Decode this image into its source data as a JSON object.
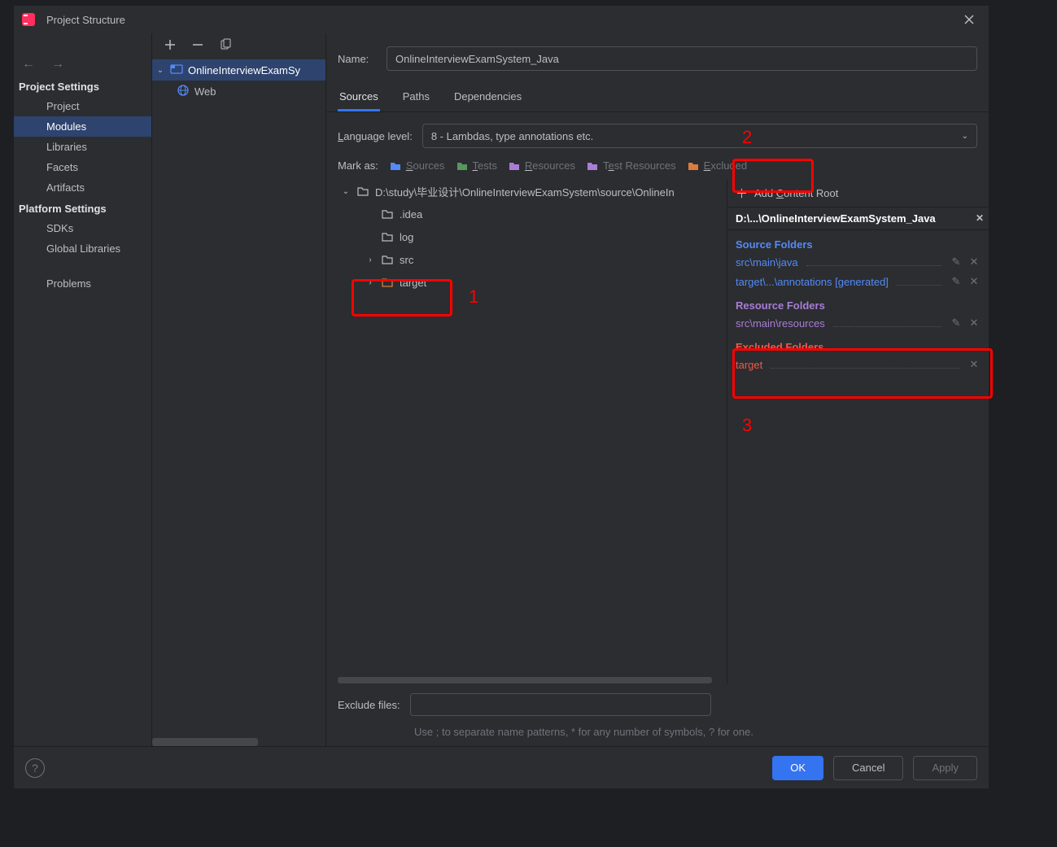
{
  "window": {
    "title": "Project Structure"
  },
  "sidebar": {
    "settings_label": "Project Settings",
    "items": [
      {
        "label": "Project"
      },
      {
        "label": "Modules"
      },
      {
        "label": "Libraries"
      },
      {
        "label": "Facets"
      },
      {
        "label": "Artifacts"
      }
    ],
    "platform_label": "Platform Settings",
    "platform_items": [
      {
        "label": "SDKs"
      },
      {
        "label": "Global Libraries"
      }
    ],
    "problems": "Problems"
  },
  "modules_tree": {
    "root": "OnlineInterviewExamSy",
    "child": "Web"
  },
  "main": {
    "name_label": "Name:",
    "name_value": "OnlineInterviewExamSystem_Java",
    "tabs": [
      "Sources",
      "Paths",
      "Dependencies"
    ],
    "lang_label": "Language level:",
    "lang_value": "8 - Lambdas, type annotations etc.",
    "mark_label": "Mark as:",
    "marks": [
      "Sources",
      "Tests",
      "Resources",
      "Test Resources",
      "Excluded"
    ],
    "folders": {
      "root": "D:\\study\\毕业设计\\OnlineInterviewExamSystem\\source\\OnlineIn",
      "items": [
        {
          "name": ".idea"
        },
        {
          "name": "log"
        },
        {
          "name": "src"
        },
        {
          "name": "target"
        }
      ]
    },
    "content_root": {
      "add_label": "Add Content Root",
      "path": "D:\\...\\OnlineInterviewExamSystem_Java",
      "source_folders_label": "Source Folders",
      "source_folders": [
        "src\\main\\java",
        "target\\...\\annotations [generated]"
      ],
      "resource_folders_label": "Resource Folders",
      "resource_folders": [
        "src\\main\\resources"
      ],
      "excluded_folders_label": "Excluded Folders",
      "excluded_folders": [
        "target"
      ]
    },
    "exclude_label": "Exclude files:",
    "exclude_hint": "Use ; to separate name patterns, * for any number of symbols, ? for one."
  },
  "footer": {
    "ok": "OK",
    "cancel": "Cancel",
    "apply": "Apply"
  },
  "annotations": {
    "a1": "1",
    "a2": "2",
    "a3": "3"
  }
}
